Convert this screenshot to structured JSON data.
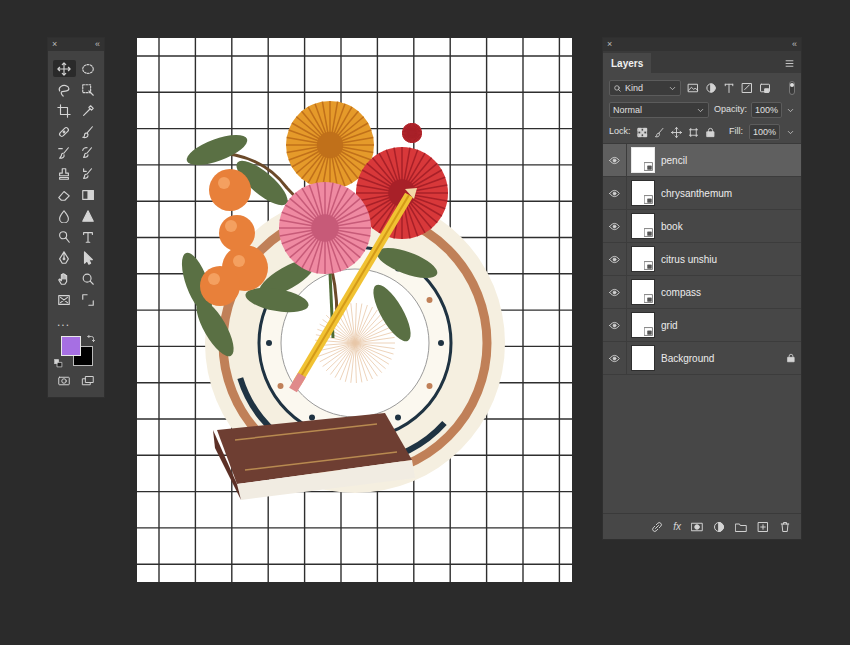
{
  "tools_panel": {
    "close": "×",
    "collapse": "«",
    "tools": [
      {
        "selected": true
      },
      {
        "selected": false
      },
      {
        "selected": false
      },
      {
        "selected": false
      },
      {
        "selected": false
      },
      {
        "selected": false
      },
      {
        "selected": false
      },
      {
        "selected": false
      },
      {
        "selected": false
      },
      {
        "selected": false
      },
      {
        "selected": false
      },
      {
        "selected": false
      },
      {
        "selected": false
      },
      {
        "selected": false
      },
      {
        "selected": false
      },
      {
        "selected": false
      },
      {
        "selected": false
      },
      {
        "selected": false
      },
      {
        "selected": false
      },
      {
        "selected": false
      },
      {
        "selected": false
      },
      {
        "selected": false
      },
      {
        "selected": false
      },
      {
        "selected": false
      }
    ],
    "more": "...",
    "foreground_color": "#a66fe3",
    "background_color": "#000000"
  },
  "layers_panel": {
    "close": "×",
    "collapse": "«",
    "tab": {
      "label": "Layers",
      "selected": true
    },
    "filter": "Kind",
    "blend_mode": "Normal",
    "opacity_label": "Opacity:",
    "opacity": "100%",
    "lock_label": "Lock:",
    "fill_label": "Fill:",
    "fill": "100%",
    "layers": [
      {
        "name": "pencil",
        "visible": true,
        "selected": true,
        "locked": false,
        "smart_object": true
      },
      {
        "name": "chrysanthemum",
        "visible": true,
        "selected": false,
        "locked": false,
        "smart_object": true
      },
      {
        "name": "book",
        "visible": true,
        "selected": false,
        "locked": false,
        "smart_object": true
      },
      {
        "name": "citrus unshiu",
        "visible": true,
        "selected": false,
        "locked": false,
        "smart_object": true
      },
      {
        "name": "compass",
        "visible": true,
        "selected": false,
        "locked": false,
        "smart_object": true
      },
      {
        "name": "grid",
        "visible": true,
        "selected": false,
        "locked": false,
        "smart_object": true
      },
      {
        "name": "Background",
        "visible": true,
        "selected": false,
        "locked": true,
        "smart_object": false
      }
    ],
    "footer_effects": "fx"
  }
}
